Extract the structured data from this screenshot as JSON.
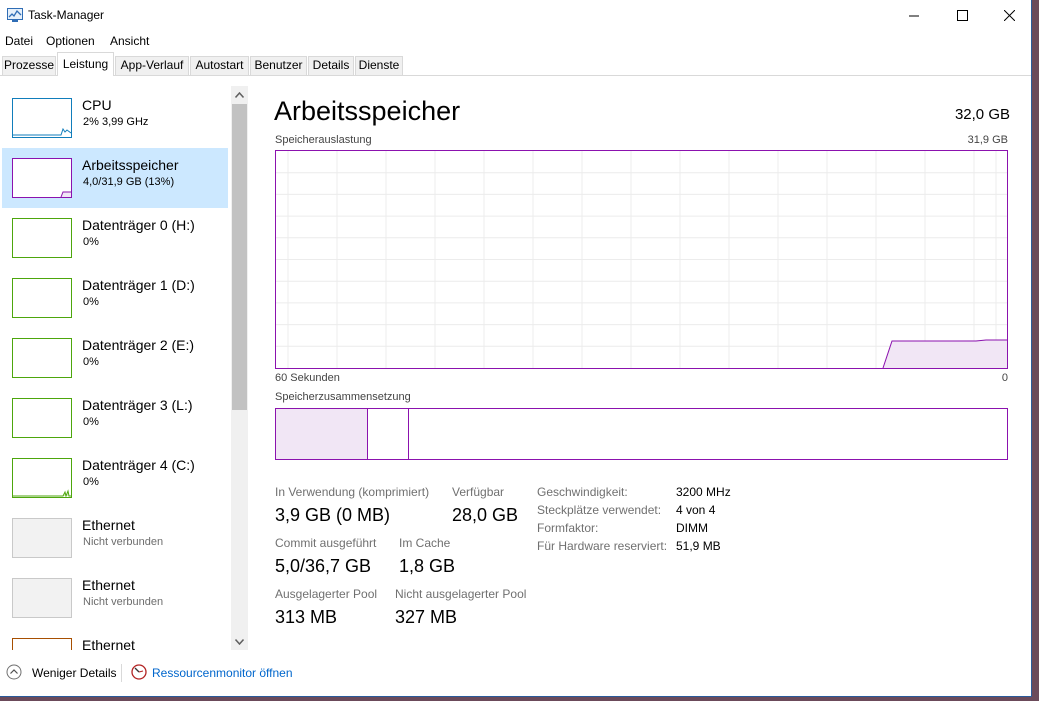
{
  "window": {
    "title": "Task-Manager"
  },
  "menu": [
    "Datei",
    "Optionen",
    "Ansicht"
  ],
  "tabs": [
    {
      "label": "Prozesse",
      "active": false
    },
    {
      "label": "Leistung",
      "active": true
    },
    {
      "label": "App-Verlauf",
      "active": false
    },
    {
      "label": "Autostart",
      "active": false
    },
    {
      "label": "Benutzer",
      "active": false
    },
    {
      "label": "Details",
      "active": false
    },
    {
      "label": "Dienste",
      "active": false
    }
  ],
  "sidebar": {
    "items": [
      {
        "name": "CPU",
        "sub": "2% 3,99 GHz",
        "color": "#117dbb"
      },
      {
        "name": "Arbeitsspeicher",
        "sub": "4,0/31,9 GB (13%)",
        "color": "#8b12ae"
      },
      {
        "name": "Datenträger 0 (H:)",
        "sub": "0%",
        "color": "#4da60c"
      },
      {
        "name": "Datenträger 1 (D:)",
        "sub": "0%",
        "color": "#4da60c"
      },
      {
        "name": "Datenträger 2 (E:)",
        "sub": "0%",
        "color": "#4da60c"
      },
      {
        "name": "Datenträger 3 (L:)",
        "sub": "0%",
        "color": "#4da60c"
      },
      {
        "name": "Datenträger 4 (C:)",
        "sub": "0%",
        "color": "#4da60c"
      },
      {
        "name": "Ethernet",
        "sub": "Nicht verbunden",
        "color": "#c9c9c9"
      },
      {
        "name": "Ethernet",
        "sub": "Nicht verbunden",
        "color": "#c9c9c9"
      },
      {
        "name": "Ethernet",
        "sub": "",
        "color": "#a74f01"
      }
    ]
  },
  "main": {
    "title": "Arbeitsspeicher",
    "total": "32,0 GB",
    "graph_label": "Speicherauslastung",
    "graph_max": "31,9 GB",
    "time_left": "60 Sekunden",
    "time_right": "0",
    "composition_label": "Speicherzusammensetzung",
    "stats": {
      "in_use_label": "In Verwendung (komprimiert)",
      "in_use": "3,9 GB (0 MB)",
      "available_label": "Verfügbar",
      "available": "28,0 GB",
      "commit_label": "Commit ausgeführt",
      "commit": "5,0/36,7 GB",
      "cached_label": "Im Cache",
      "cached": "1,8 GB",
      "paged_label": "Ausgelagerter Pool",
      "paged": "313 MB",
      "nonpaged_label": "Nicht ausgelagerter Pool",
      "nonpaged": "327 MB"
    },
    "details": [
      {
        "label": "Geschwindigkeit:",
        "value": "3200 MHz"
      },
      {
        "label": "Steckplätze verwendet:",
        "value": "4 von 4"
      },
      {
        "label": "Formfaktor:",
        "value": "DIMM"
      },
      {
        "label": "Für Hardware reserviert:",
        "value": "51,9 MB"
      }
    ]
  },
  "bottom": {
    "fewer_details": "Weniger Details",
    "resource_monitor": "Ressourcenmonitor öffnen"
  },
  "colors": {
    "memory": "#8b12ae",
    "disk": "#4da60c",
    "cpu": "#117dbb",
    "selected": "#cce8ff"
  }
}
